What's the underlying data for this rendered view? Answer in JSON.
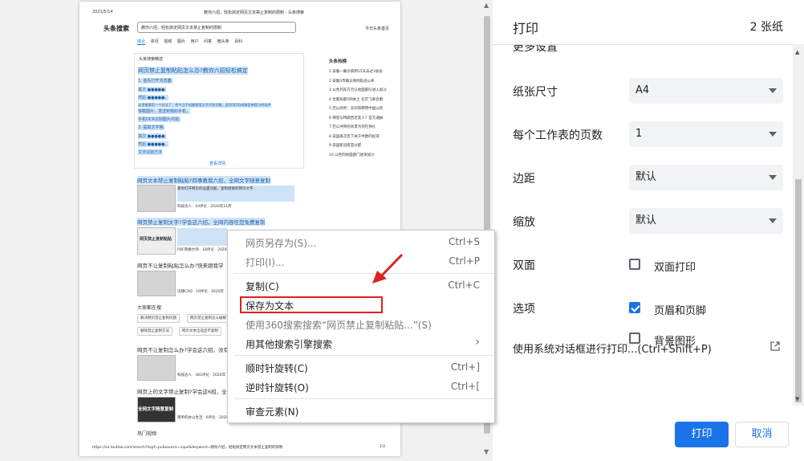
{
  "preview": {
    "date": "2021/5/14",
    "page_title": "教你六招，轻松搞定网页文本禁止复制的限制 - 头条搜索",
    "logo": "头条搜索",
    "search_text": "教你六招，轻松搞定网页文本禁止复制的限制",
    "nav_right": "今日头条首页",
    "tabs": [
      "综合",
      "资讯",
      "视频",
      "图片",
      "用户",
      "问答",
      "微头条",
      "百科"
    ],
    "featured_source": "头条搜索精选",
    "featured_title": "网页禁止复制粘贴怎么办?教你六招轻松搞定",
    "featured_lines": [
      "1. 首先打开浏览器;",
      "其次 ●●●●●;",
      "然后 ●●●●●。",
      "这里需要用一个办法了，把今日手机截图用文字识别功能，虽为用QQ或微信带提示的软件",
      "将截图片，发送到我的手机。",
      "手机OCR识别图片内容;",
      "2. 提取文字格;",
      "其次 ●●●●●;",
      "然后 ●●●●●。",
      "文字识别方法"
    ],
    "featured_more": "查看详情",
    "side_title": "头条热榜",
    "side_items": [
      "1 安徽一确诊病例15天去过3省份",
      "2 安徽3市确诊病例轨迹公布",
      "3 以色列军方否认地面部队进入加沙",
      "4 合肥局部5例本土 北京飞离合肥",
      "5 巴以局势：毕剑等聘用中国公民",
      "6 拜登与特朗普老友人？官方通报",
      "7 巴以冲突的背景为何在挣扎",
      "8 美国再次签下关于中欧的投资",
      "9 美国新冠疫苗分配",
      "10 以色列地面部门进攻加沙"
    ],
    "result1_title": "网页文本禁止复制粘贴?四事教我六招，全网文字随意复制",
    "result1_snip": "教你打开网页的设置功能，复制想要的网页文字...",
    "result1_meta": "科技达人 · 10评论 · 2020年11月",
    "result2_title": "网页禁止复制文字?学会这六招，全网内容任您免费复制",
    "result2_thumb": "网页禁止复制粘贴",
    "result2_meta": "PDF转换大师 · 18评论 · 2020年",
    "result3_title": "网页不让复制粘贴怎么办?快来跟我学",
    "result3_meta": "迅捷CAD · 10评论 · 2020年",
    "related_title": "大家都在搜",
    "related_chips": [
      "解决网页禁止复制问题",
      "网页禁止复制怎么破解",
      "解除禁止复制方法",
      "网页文本全选后不复制"
    ],
    "result4_title": "网页不让复制怎么办?学会这六招，没有复制不了的文字",
    "result4_meta": "科技达人 · 381评论 · 2020年",
    "result5_title": "网页上的文字禁止复制?学会这6招，全网文字随意复制",
    "result5_thumb": "全网文字随意复制",
    "result5_meta": "简单的办公生活 · 6评论 · 2020年",
    "hot_video": "热门视频",
    "footer_url": "https://so.toutiao.com/search?dvpf=pc&source=input&keyword=教你六招，轻松搞定网页文本禁止复制的限制",
    "footer_page": "1/2"
  },
  "context_menu": {
    "items": [
      {
        "label": "网页另存为(S)...",
        "shortcut": "Ctrl+S",
        "disabled": true
      },
      {
        "label": "打印(I)...",
        "shortcut": "Ctrl+P",
        "disabled": true
      },
      {
        "label": "复制(C)",
        "shortcut": "Ctrl+C",
        "disabled": false
      },
      {
        "label": "保存为文本",
        "shortcut": "",
        "disabled": false
      },
      {
        "label": "使用360搜索搜索“网页禁止复制粘贴...”(S)",
        "shortcut": "",
        "disabled": true
      },
      {
        "label": "用其他搜索引擎搜索",
        "shortcut": "›",
        "disabled": false
      },
      {
        "label": "顺时针旋转(C)",
        "shortcut": "Ctrl+]",
        "disabled": false
      },
      {
        "label": "逆时针旋转(O)",
        "shortcut": "Ctrl+[",
        "disabled": false
      },
      {
        "label": "审查元素(N)",
        "shortcut": "",
        "disabled": false
      }
    ]
  },
  "print_panel": {
    "title": "打印",
    "sheet_count": "2 张纸",
    "cut_label": "更多设置",
    "paper_size_label": "纸张尺寸",
    "paper_size_value": "A4",
    "pages_per_sheet_label": "每个工作表的页数",
    "pages_per_sheet_value": "1",
    "margins_label": "边距",
    "margins_value": "默认",
    "scale_label": "缩放",
    "scale_value": "默认",
    "duplex_label": "双面",
    "duplex_option": "双面打印",
    "options_label": "选项",
    "headers_footers": "页眉和页脚",
    "background_graphics": "背景图形",
    "system_dialog": "使用系统对话框进行打印...(Ctrl+Shift+P)",
    "print_button": "打印",
    "cancel_button": "取消"
  },
  "colors": {
    "accent": "#1a73e8",
    "highlight_box": "#e02020",
    "arrow": "#e02020"
  }
}
